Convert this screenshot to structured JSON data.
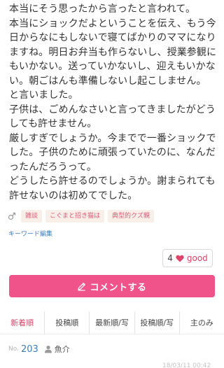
{
  "post": {
    "lines": [
      "本当にそう思ったから言ったと言われて。",
      "本当にショックだよということを伝え、もう今",
      "日からなにもしないで寝てばかりのママになり",
      "ますね。明日お弁当も作らないし、授業参観に",
      "もいかない。送っていかないし、迎えもいかな",
      "い。朝ごはんも準備しないし起こしません。",
      "と言いました。",
      "子供は、ごめんなさいと言ってきましたがどう",
      "しても許せません。",
      "厳しすぎでしょうか。今までで一番ショックで",
      "した。子供のために頑張っていたのに、なんだ",
      "ったんだろうって。",
      "どうしたら許せるのでしょうか。謝まられても",
      "許せないのは初めてでした。"
    ]
  },
  "tags": {
    "icon": "gender-symbol-icon",
    "items": [
      "雑談",
      "こぐまと招き猫は",
      "典型的クズ親"
    ]
  },
  "keyword_edit_label": "キーワード編集",
  "good": {
    "count": "4",
    "icon": "heart-icon",
    "label": "good",
    "color": "#e0436b"
  },
  "comment_button": {
    "icon": "pencil-icon",
    "label": "コメントする",
    "color": "#f0528a"
  },
  "sort_tabs": [
    {
      "label": "新着順",
      "active": true
    },
    {
      "label": "投稿順",
      "active": false
    },
    {
      "label": "最新順/写",
      "active": false
    },
    {
      "label": "投稿順/写",
      "active": false
    },
    {
      "label": "主のみ",
      "active": false
    }
  ],
  "comment": {
    "no_label": "No.",
    "no_value": "203",
    "user_icon": "user-icon",
    "user_name": "魚介",
    "timestamp": "18/03/11 00:42"
  }
}
